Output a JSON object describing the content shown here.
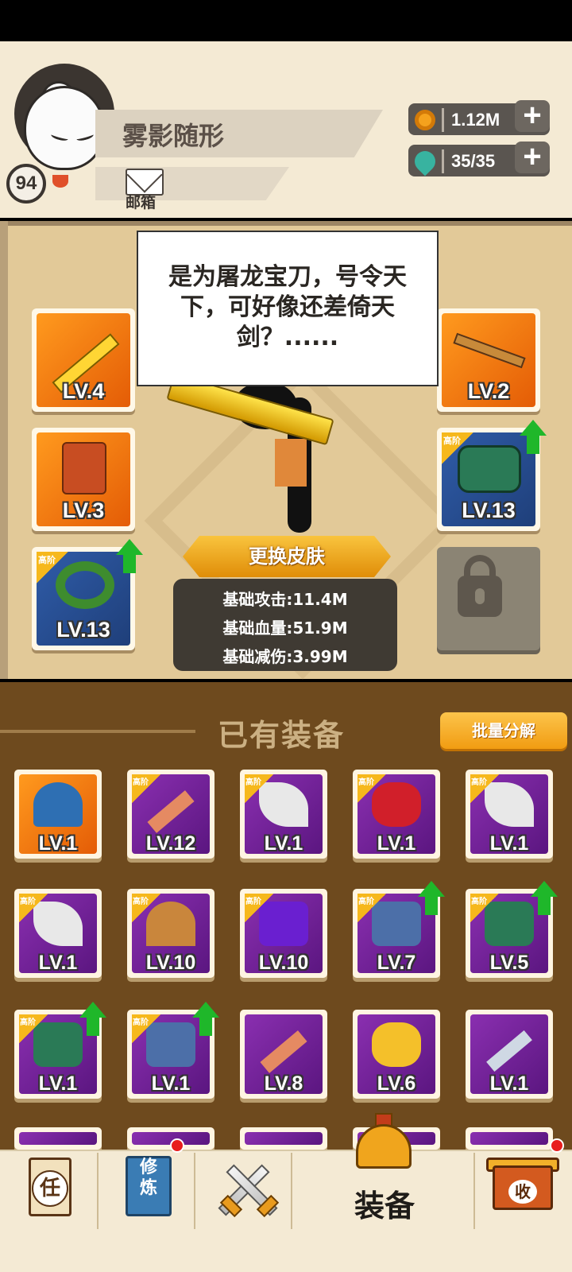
{
  "header": {
    "player_name": "雾影随形",
    "player_level": "94",
    "mail_label": "邮箱",
    "resources": {
      "gold": "1.12M",
      "stamina": "35/35"
    }
  },
  "hero": {
    "speech": "是为屠龙宝刀，号令天下，可好像还差倚天剑？......",
    "change_skin_label": "更换皮肤",
    "stats": {
      "attack": "基础攻击:11.4M",
      "hp": "基础血量:51.9M",
      "damage_reduction": "基础减伤:3.99M"
    },
    "slots": {
      "weapon": "LV.4",
      "armor": "LV.3",
      "ring": "LV.13",
      "key": "LV.2",
      "bracer": "LV.13"
    },
    "tier_label": "高阶"
  },
  "inventory": {
    "title": "已有装备",
    "batch_label": "批量分解",
    "items": [
      {
        "lv": "LV.1",
        "tier": ""
      },
      {
        "lv": "LV.12",
        "tier": "高阶"
      },
      {
        "lv": "LV.1",
        "tier": "高阶"
      },
      {
        "lv": "LV.1",
        "tier": "高阶"
      },
      {
        "lv": "LV.1",
        "tier": "高阶"
      },
      {
        "lv": "LV.1",
        "tier": "高阶"
      },
      {
        "lv": "LV.10",
        "tier": "高阶"
      },
      {
        "lv": "LV.10",
        "tier": "高阶"
      },
      {
        "lv": "LV.7",
        "tier": "高阶"
      },
      {
        "lv": "LV.5",
        "tier": "高阶"
      },
      {
        "lv": "LV.1",
        "tier": "高阶"
      },
      {
        "lv": "LV.1",
        "tier": "高阶"
      },
      {
        "lv": "LV.8",
        "tier": ""
      },
      {
        "lv": "LV.6",
        "tier": ""
      },
      {
        "lv": "LV.1",
        "tier": ""
      }
    ]
  },
  "nav": {
    "tasks_glyph": "任",
    "cultivate_glyph": "修炼",
    "equip_label": "装备",
    "collect_glyph": "收"
  },
  "colors": {
    "gold_accent": "#f5a21d",
    "upgrade_green": "#1fb72a",
    "purple_tier": "#8a2fb0",
    "orange_tier": "#e45c06"
  }
}
